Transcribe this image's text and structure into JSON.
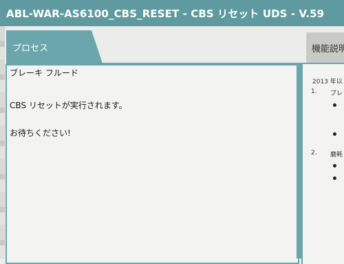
{
  "window": {
    "title": "ABL-WAR-AS6100_CBS_RESET - CBS リセット UDS - V.59"
  },
  "tabs": {
    "process": "プロセス",
    "description": "機能説明"
  },
  "process_panel": {
    "lines": [
      "ブレーキ フルード",
      "CBS リセットが実行されます。",
      "お待ちください!"
    ]
  },
  "description_panel": {
    "intro": "2013 年以",
    "items": [
      {
        "number": "1.",
        "text": "ブレ"
      },
      {
        "number": "2.",
        "text": "磨耗"
      }
    ]
  },
  "colors": {
    "accent": "#5e9aa0",
    "tab_active": "#6aa6ac",
    "tab_inactive": "#c9c9c6",
    "panel_bg": "#f3f3f1"
  }
}
